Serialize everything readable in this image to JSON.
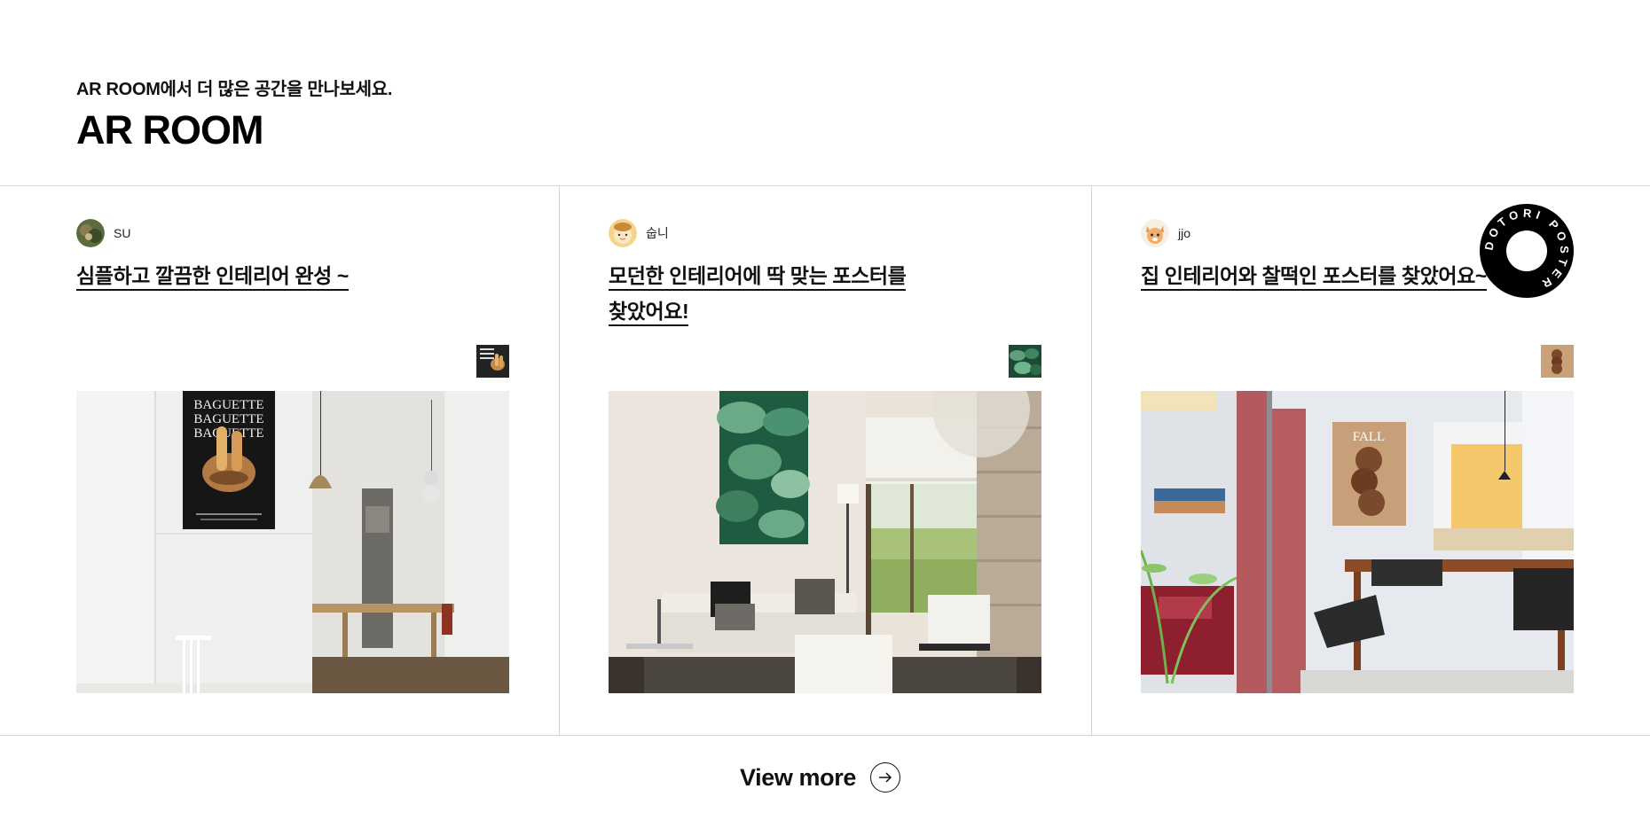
{
  "header": {
    "subtitle": "AR ROOM에서 더 많은 공간을 만나보세요.",
    "title": "AR ROOM"
  },
  "cards": [
    {
      "author": "SU",
      "title": "심플하고 깔끔한 인테리어 완성 ~",
      "poster_text": [
        "BAGUETTE",
        "BAGUETTE",
        "BAGUETTE"
      ]
    },
    {
      "author": "숩니",
      "title_lines": [
        "모던한 인테리어에 딱 맞는 포스터를",
        "찾았어요!"
      ]
    },
    {
      "author": "jjo",
      "title": "집 인테리어와 찰떡인 포스터를 찾았어요~",
      "poster_text": "FALL"
    }
  ],
  "badge": {
    "text": "DOTORI POSTER"
  },
  "view_more": {
    "label": "View more",
    "icon": "arrow-right-icon"
  }
}
